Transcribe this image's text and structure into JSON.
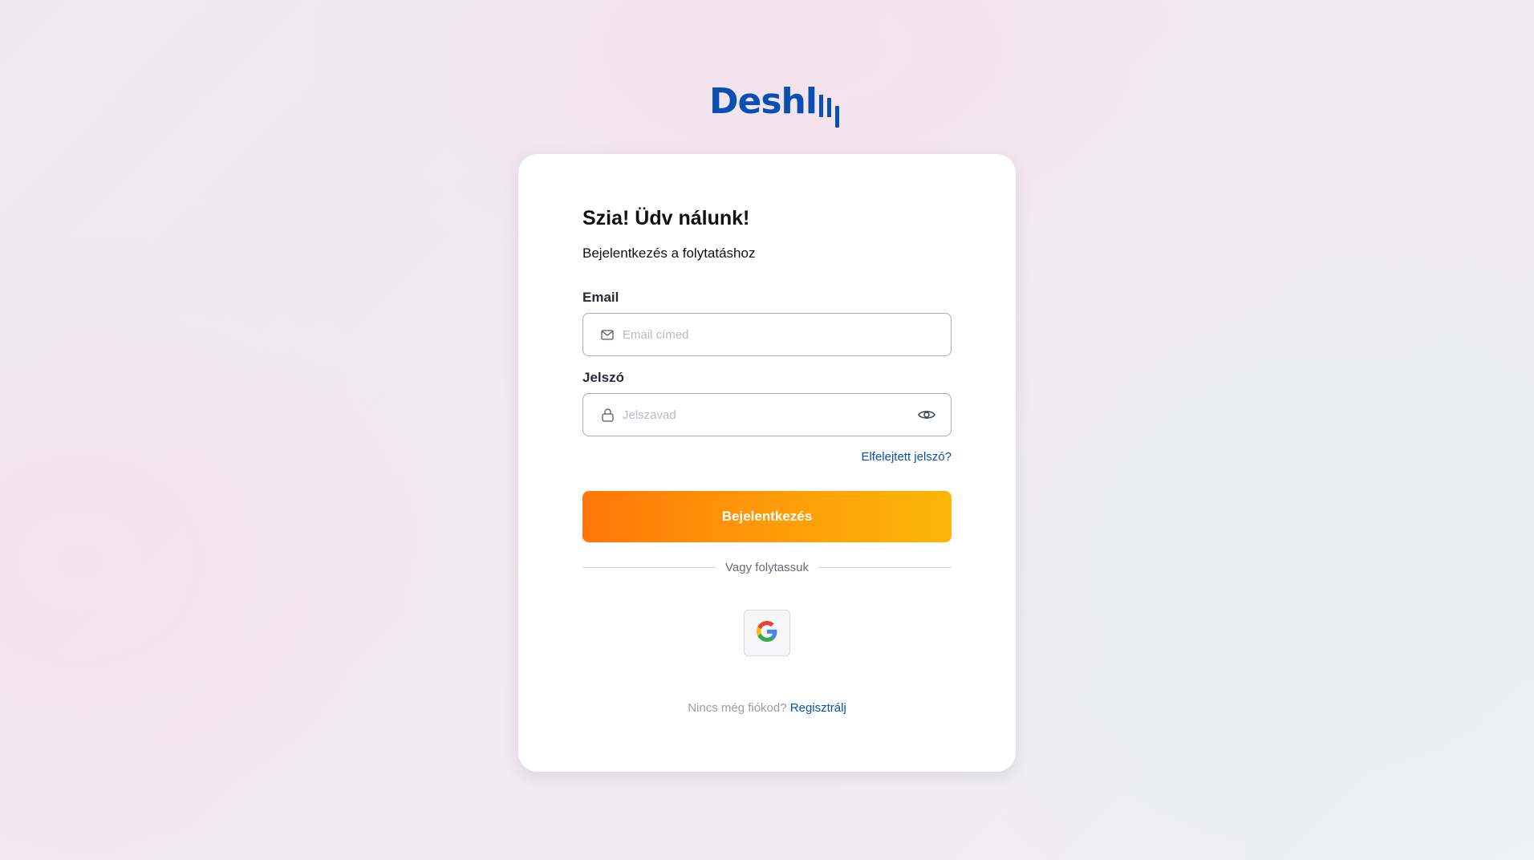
{
  "brand": {
    "name": "Deshl",
    "color": "#0b4fb0"
  },
  "login": {
    "title": "Szia! Üdv nálunk!",
    "subtitle": "Bejelentkezés a folytatáshoz",
    "email": {
      "label": "Email",
      "placeholder": "Email címed",
      "value": "",
      "icon": "mail-icon"
    },
    "password": {
      "label": "Jelszó",
      "placeholder": "Jelszavad",
      "value": "",
      "icon": "lock-icon",
      "toggle_icon": "eye-icon"
    },
    "forgot_label": "Elfelejtett jelszó?",
    "submit_label": "Bejelentkezés",
    "submit_gradient": [
      "#ff7708",
      "#fbb60a"
    ],
    "divider_label": "Vagy folytassuk",
    "social": [
      {
        "provider": "Google",
        "icon": "google-icon"
      }
    ],
    "register_prompt": "Nincs még fiókod?",
    "register_link": "Regisztrálj"
  }
}
